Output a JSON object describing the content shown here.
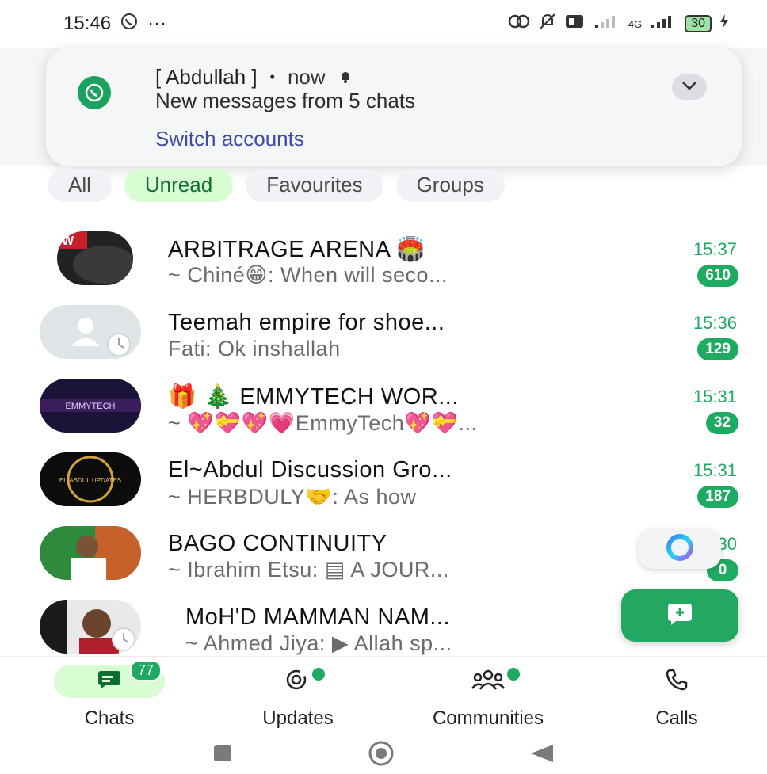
{
  "status_bar": {
    "time": "15:46",
    "more": "···",
    "network_4g": "4G",
    "battery": "30"
  },
  "notification": {
    "sender": "[ Abdullah ]",
    "separator": "•",
    "time": "now",
    "body": "New messages from 5 chats",
    "action": "Switch accounts"
  },
  "filters": [
    {
      "label": "All",
      "active": false
    },
    {
      "label": "Unread",
      "active": true
    },
    {
      "label": "Favourites",
      "active": false
    },
    {
      "label": "Groups",
      "active": false
    }
  ],
  "chats": [
    {
      "name": "ARBITRAGE ARENA 🏟️",
      "time": "15:37",
      "preview": "~ Chiné😁: When will seco...",
      "unread": "610"
    },
    {
      "name": "Teemah empire for shoe...",
      "time": "15:36",
      "preview": "Fati: Ok inshallah",
      "unread": "129"
    },
    {
      "name": "🎁 🎄 EMMYTECH WOR...",
      "time": "15:31",
      "preview": "~ 💖💝💖💗EmmyTech💖💝...",
      "unread": "32"
    },
    {
      "name": "El~Abdul Discussion Gro...",
      "time": "15:31",
      "preview": "~ HERBDULY🤝: As how",
      "unread": "187"
    },
    {
      "name": "BAGO CONTINUITY",
      "time": "15:30",
      "preview": "~ Ibrahim Etsu: ▤ A JOUR...",
      "unread": "0"
    },
    {
      "name": "MoH'D MAMMAN NAM...",
      "time": "",
      "preview": "~ Ahmed Jiya: ▶ Allah sp...",
      "unread": ""
    }
  ],
  "avatar_text": {
    "emmytech": "EMMYTECH",
    "elabdul": "EL-ABDUL UPDATES"
  },
  "bottom_nav": [
    {
      "label": "Chats",
      "badge": "77",
      "active": true
    },
    {
      "label": "Updates",
      "dot": true
    },
    {
      "label": "Communities",
      "dot": true
    },
    {
      "label": "Calls"
    }
  ],
  "colors": {
    "accent": "#1daa61",
    "active_chip": "#d8fdd2",
    "link": "#3c4aa8"
  }
}
